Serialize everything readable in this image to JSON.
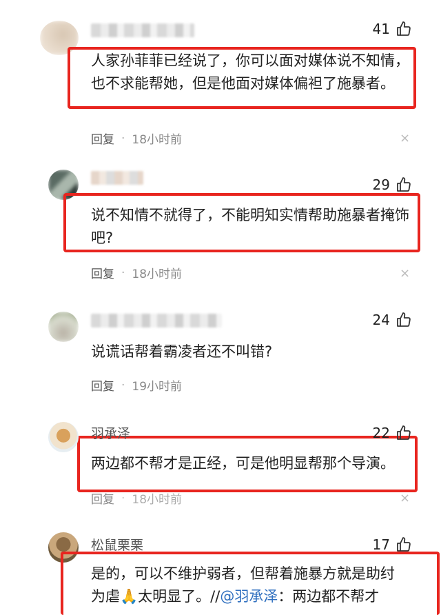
{
  "comments": [
    {
      "likes": "41",
      "text": "人家孙菲菲已经说了，你可以面对媒体说不知情，也不求能帮她，但是他面对媒体偏袒了施暴者。",
      "reply": "回复",
      "time": "18小时前"
    },
    {
      "likes": "29",
      "text": "说不知情不就得了，不能明知实情帮助施暴者掩饰吧?",
      "reply": "回复",
      "time": "18小时前"
    },
    {
      "likes": "24",
      "text": "说谎话帮着霸凌者还不叫错?",
      "reply": "回复",
      "time": "19小时前"
    },
    {
      "name": "羽承泽",
      "likes": "22",
      "text": "两边都不帮才是正经，可是他明显帮那个导演。",
      "reply": "回复",
      "time": "18小时前"
    },
    {
      "name": "松鼠栗栗",
      "likes": "17",
      "text_line1": "是的，可以不维护弱者，但帮着施暴方就是助纣",
      "text_line2_a": "为虐",
      "text_line2_b": "太明显了。//",
      "mention": "@羽承泽",
      "text_line2_c": "：两边都不帮才"
    }
  ],
  "icons": {
    "like": "thumbs-up-icon",
    "close": "close-icon",
    "hands": "praying-hands-emoji"
  },
  "colors": {
    "highlight": "#e8251f",
    "mention": "#2f6fbf"
  }
}
